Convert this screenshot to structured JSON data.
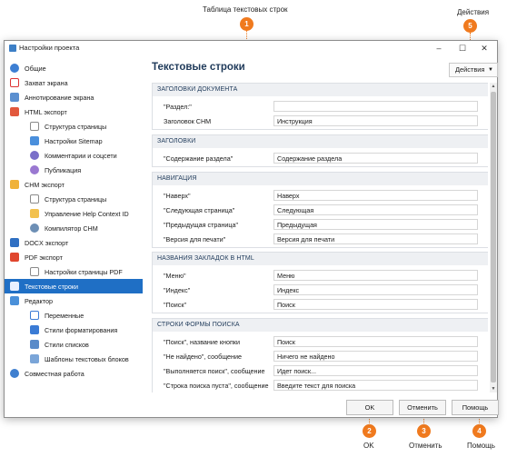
{
  "annotations": {
    "table_label": "Таблица текстовых строк",
    "actions_label": "Действия",
    "ok_label": "OK",
    "cancel_label": "Отменить",
    "help_label": "Помощь",
    "badges": [
      "1",
      "2",
      "3",
      "4",
      "5"
    ],
    "accent_color": "#f07a1e"
  },
  "window": {
    "title": "Настройки проекта",
    "controls": [
      "–",
      "☐",
      "✕"
    ]
  },
  "sidebar": {
    "items": [
      {
        "label": "Общие",
        "icon": "gear-icon"
      },
      {
        "label": "Захват экрана",
        "icon": "screen-capture-icon"
      },
      {
        "label": "Аннотирование экрана",
        "icon": "annotation-icon"
      },
      {
        "label": "HTML экспорт",
        "icon": "html-icon"
      },
      {
        "label": "Структура страницы",
        "icon": "page-structure-icon"
      },
      {
        "label": "Настройки Sitemap",
        "icon": "sitemap-icon"
      },
      {
        "label": "Комментарии и соцсети",
        "icon": "comments-icon"
      },
      {
        "label": "Публикация",
        "icon": "cloud-icon"
      },
      {
        "label": "CHM экспорт",
        "icon": "chm-icon"
      },
      {
        "label": "Структура страницы",
        "icon": "page-structure-icon"
      },
      {
        "label": "Управление Help Context ID",
        "icon": "context-id-icon"
      },
      {
        "label": "Компилятор CHM",
        "icon": "compiler-icon"
      },
      {
        "label": "DOCX экспорт",
        "icon": "docx-icon"
      },
      {
        "label": "PDF экспорт",
        "icon": "pdf-icon"
      },
      {
        "label": "Настройки страницы PDF",
        "icon": "pdf-page-icon"
      },
      {
        "label": "Текстовые строки",
        "icon": "text-strings-icon"
      },
      {
        "label": "Редактор",
        "icon": "editor-icon"
      },
      {
        "label": "Переменные",
        "icon": "variables-icon"
      },
      {
        "label": "Стили форматирования",
        "icon": "text-style-icon"
      },
      {
        "label": "Стили списков",
        "icon": "list-style-icon"
      },
      {
        "label": "Шаблоны текстовых блоков",
        "icon": "text-block-icon"
      },
      {
        "label": "Совместная работа",
        "icon": "collaboration-icon"
      }
    ],
    "selected_color": "#1f6fc5"
  },
  "main": {
    "title": "Текстовые строки",
    "actions_button": "Действия",
    "sections": [
      {
        "header": "ЗАГОЛОВКИ ДОКУМЕНТА",
        "rows": [
          {
            "label": "\"Раздел:\"",
            "value": ""
          },
          {
            "label": "Заголовок CHM",
            "value": "Инструкция"
          }
        ]
      },
      {
        "header": "ЗАГОЛОВКИ",
        "rows": [
          {
            "label": "\"Содержание раздела\"",
            "value": "Содержание раздела"
          }
        ]
      },
      {
        "header": "НАВИГАЦИЯ",
        "rows": [
          {
            "label": "\"Наверх\"",
            "value": "Наверх"
          },
          {
            "label": "\"Следующая страница\"",
            "value": "Следующая"
          },
          {
            "label": "\"Предыдущая страница\"",
            "value": "Предыдущая"
          },
          {
            "label": "\"Версия для печати\"",
            "value": "Версия для печати"
          }
        ]
      },
      {
        "header": "НАЗВАНИЯ ЗАКЛАДОК В HTML",
        "rows": [
          {
            "label": "\"Меню\"",
            "value": "Меню"
          },
          {
            "label": "\"Индекс\"",
            "value": "Индекс"
          },
          {
            "label": "\"Поиск\"",
            "value": "Поиск"
          }
        ]
      },
      {
        "header": "СТРОКИ ФОРМЫ ПОИСКА",
        "rows": [
          {
            "label": "\"Поиск\", название кнопки",
            "value": "Поиск"
          },
          {
            "label": "\"Не найдено\", сообщение",
            "value": "Ничего не найдено"
          },
          {
            "label": "\"Выполняется поиск\", сообщение",
            "value": "Идет поиск..."
          },
          {
            "label": "\"Строка поиска пуста\", сообщение",
            "value": "Введите текст для поиска"
          }
        ]
      }
    ]
  },
  "footer": {
    "ok": "OK",
    "cancel": "Отменить",
    "help": "Помощь"
  }
}
